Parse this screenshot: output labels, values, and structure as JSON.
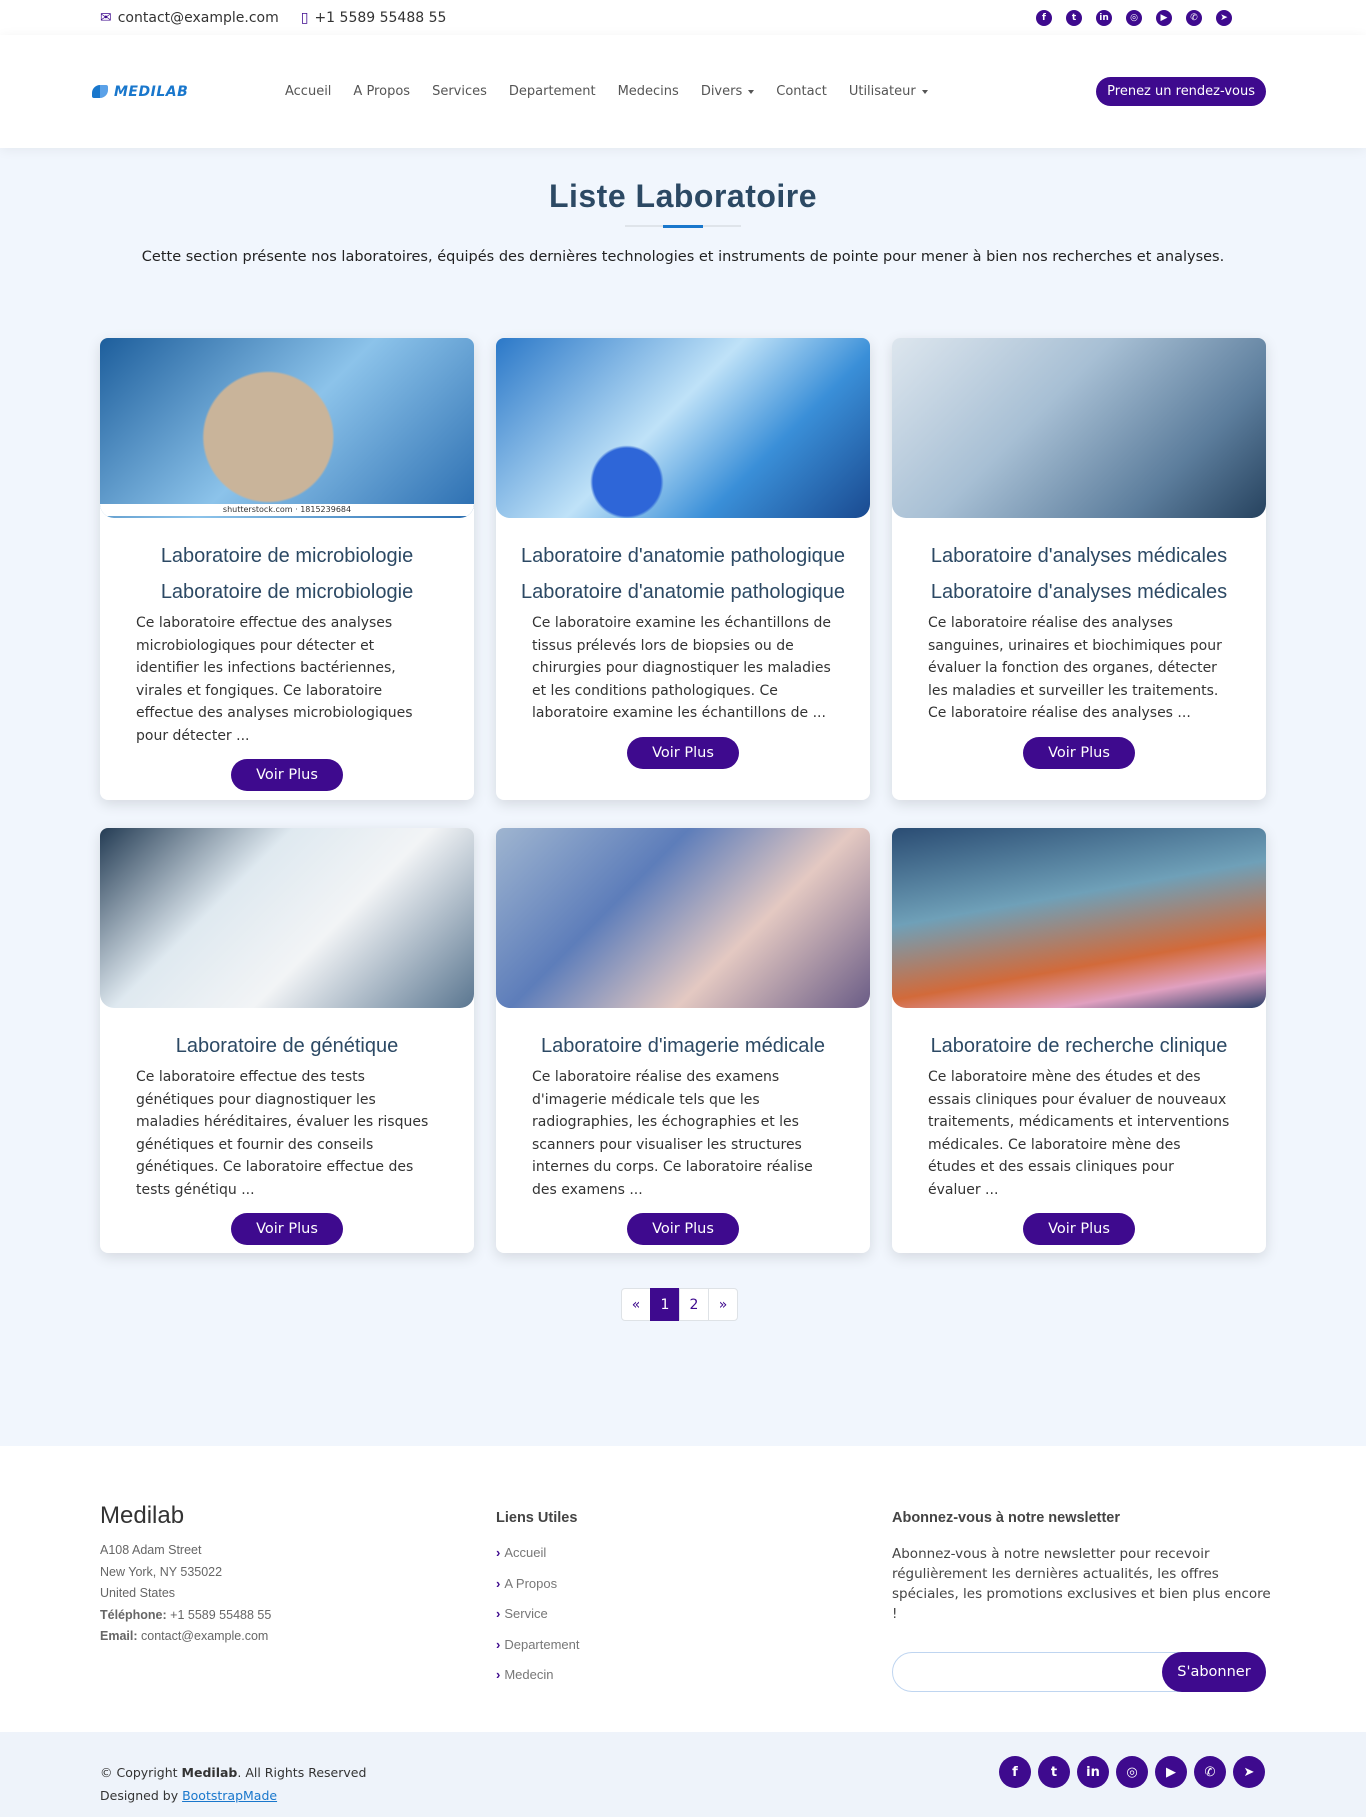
{
  "topbar": {
    "email": "contact@example.com",
    "phone": "+1 5589 55488 55",
    "social": [
      "facebook-icon",
      "twitter-icon",
      "linkedin-icon",
      "instagram-icon",
      "youtube-icon",
      "whatsapp-icon",
      "telegram-icon"
    ]
  },
  "header": {
    "logo": "MEDILAB",
    "nav": [
      "Accueil",
      "A Propos",
      "Services",
      "Departement",
      "Medecins",
      "Divers",
      "Contact",
      "Utilisateur"
    ],
    "appointment": "Prenez un rendez-vous"
  },
  "section": {
    "title": "Liste Laboratoire",
    "description": "Cette section présente nos laboratoires, équipés des dernières technologies et instruments de pointe pour mener à bien nos recherches et analyses."
  },
  "cards": [
    {
      "title": "Laboratoire de microbiologie",
      "subtitle": "Laboratoire de microbiologie",
      "caption": "shutterstock.com · 1815239684",
      "desc": "Ce laboratoire effectue des analyses microbiologiques pour détecter et identifier les infections bactériennes, virales et fongiques. Ce laboratoire effectue des analyses microbiologiques pour détecter ...",
      "button": "Voir Plus"
    },
    {
      "title": "Laboratoire d'anatomie pathologique",
      "subtitle": "Laboratoire d'anatomie pathologique",
      "desc": "Ce laboratoire examine les échantillons de tissus prélevés lors de biopsies ou de chirurgies pour diagnostiquer les maladies et les conditions pathologiques. Ce laboratoire examine les échantillons de ...",
      "button": "Voir Plus"
    },
    {
      "title": "Laboratoire d'analyses médicales",
      "subtitle": "Laboratoire d'analyses médicales",
      "desc": "Ce laboratoire réalise des analyses sanguines, urinaires et biochimiques pour évaluer la fonction des organes, détecter les maladies et surveiller les traitements. Ce laboratoire réalise des analyses ...",
      "button": "Voir Plus"
    },
    {
      "title": "Laboratoire de génétique",
      "desc": "Ce laboratoire effectue des tests génétiques pour diagnostiquer les maladies héréditaires, évaluer les risques génétiques et fournir des conseils génétiques. Ce laboratoire effectue des tests génétiqu ...",
      "button": "Voir Plus"
    },
    {
      "title": "Laboratoire d'imagerie médicale",
      "desc": "Ce laboratoire réalise des examens d'imagerie médicale tels que les radiographies, les échographies et les scanners pour visualiser les structures internes du corps. Ce laboratoire réalise des examens ...",
      "button": "Voir Plus"
    },
    {
      "title": "Laboratoire de recherche clinique",
      "desc": "Ce laboratoire mène des études et des essais cliniques pour évaluer de nouveaux traitements, médicaments et interventions médicales. Ce laboratoire mène des études et des essais cliniques pour évaluer ...",
      "button": "Voir Plus"
    }
  ],
  "pagination": [
    "«",
    "1",
    "2",
    "»"
  ],
  "footer": {
    "brand": "Medilab",
    "address1": "A108 Adam Street",
    "address2": "New York, NY 535022",
    "address3": "United States",
    "phone_label": "Téléphone:",
    "phone": "+1 5589 55488 55",
    "email_label": "Email:",
    "email": "contact@example.com",
    "links_title": "Liens Utiles",
    "links": [
      "Accueil",
      "A Propos",
      "Service",
      "Departement",
      "Medecin"
    ],
    "newsletter_title": "Abonnez-vous à notre newsletter",
    "newsletter_text": "Abonnez-vous à notre newsletter pour recevoir régulièrement les dernières actualités, les offres spéciales, les promotions exclusives et bien plus encore !",
    "subscribe_button": "S'abonner",
    "copyright_prefix": "© Copyright",
    "copyright_brand": "Medilab",
    "copyright_suffix": ". All Rights Reserved",
    "designed_by": "Designed by",
    "designer": "BootstrapMade"
  },
  "colors": {
    "primary": "#3e0a8e",
    "accent": "#1977cc",
    "title": "#2c4964",
    "background": "#f1f6fd"
  }
}
